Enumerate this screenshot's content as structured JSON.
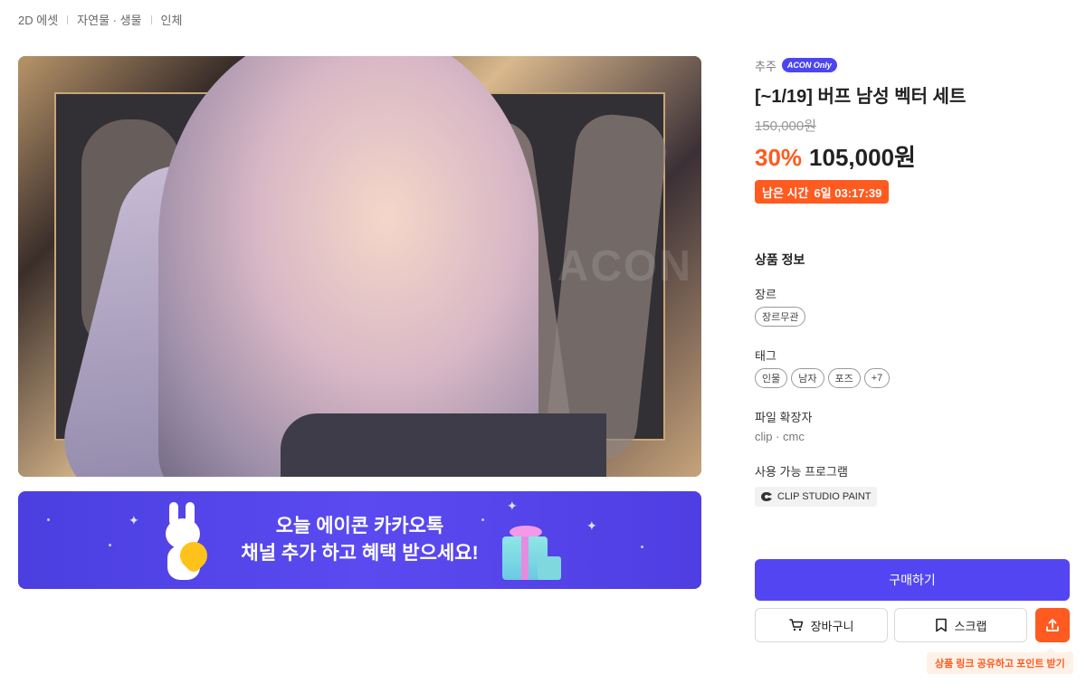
{
  "breadcrumb": [
    "2D 에셋",
    "자연물 · 생물",
    "인체"
  ],
  "hero": {
    "watermark": "ACON"
  },
  "banner": {
    "line1": "오늘 에이콘 카카오톡",
    "line2": "채널 추가 하고 혜택 받으세요!"
  },
  "product": {
    "seller": "추주",
    "badge": "ACON Only",
    "title": "[~1/19] 버프 남성 벡터 세트",
    "original_price": "150,000원",
    "discount": "30%",
    "price": "105,000원",
    "timer_label": "남은 시간",
    "timer_value": "6일 03:17:39"
  },
  "info": {
    "section_title": "상품 정보",
    "genre_label": "장르",
    "genre_chips": [
      "장르무관"
    ],
    "tag_label": "태그",
    "tag_chips": [
      "인물",
      "남자",
      "포즈",
      "+7"
    ],
    "ext_label": "파일 확장자",
    "ext_value": "clip · cmc",
    "program_label": "사용 가능 프로그램",
    "program_value": "CLIP STUDIO PAINT"
  },
  "actions": {
    "buy": "구매하기",
    "cart": "장바구니",
    "scrap": "스크랩",
    "share_tooltip": "상품 링크 공유하고 포인트 받기"
  },
  "colors": {
    "accent": "#5346f2",
    "sale": "#ff5a1f"
  }
}
